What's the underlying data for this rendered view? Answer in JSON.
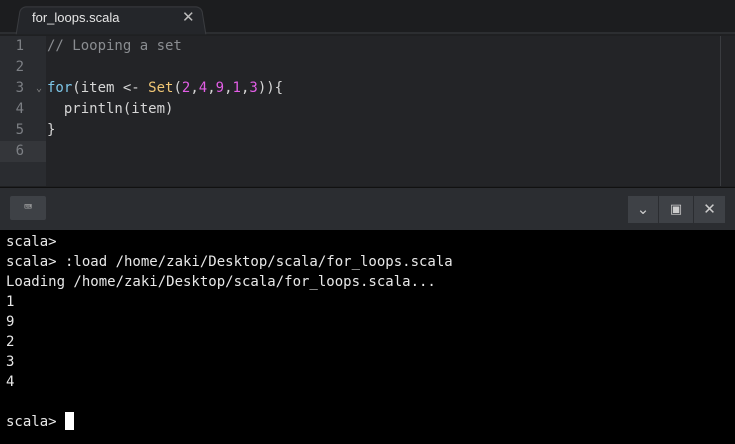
{
  "tab": {
    "title": "for_loops.scala",
    "close": "✕"
  },
  "editor": {
    "line_numbers": [
      "1",
      "2",
      "3",
      "4",
      "5",
      "6"
    ],
    "lines": [
      [
        {
          "t": "// Looping a set",
          "c": "cm"
        }
      ],
      [],
      [
        {
          "t": "for",
          "c": "kw"
        },
        {
          "t": "(item <- "
        },
        {
          "t": "Set",
          "c": "ty"
        },
        {
          "t": "("
        },
        {
          "t": "2",
          "c": "nu"
        },
        {
          "t": ","
        },
        {
          "t": "4",
          "c": "nu"
        },
        {
          "t": ","
        },
        {
          "t": "9",
          "c": "nu"
        },
        {
          "t": ","
        },
        {
          "t": "1",
          "c": "nu"
        },
        {
          "t": ","
        },
        {
          "t": "3",
          "c": "nu"
        },
        {
          "t": ")){"
        }
      ],
      [
        {
          "t": "  println(item)"
        }
      ],
      [
        {
          "t": "}"
        }
      ],
      []
    ]
  },
  "panel": {
    "keyboard": "⌨",
    "collapse": "⌄",
    "maximize": "▣",
    "close": "✕"
  },
  "terminal": {
    "lines": [
      "scala>",
      "scala> :load /home/zaki/Desktop/scala/for_loops.scala",
      "Loading /home/zaki/Desktop/scala/for_loops.scala...",
      "1",
      "9",
      "2",
      "3",
      "4",
      ""
    ],
    "prompt": "scala> "
  }
}
